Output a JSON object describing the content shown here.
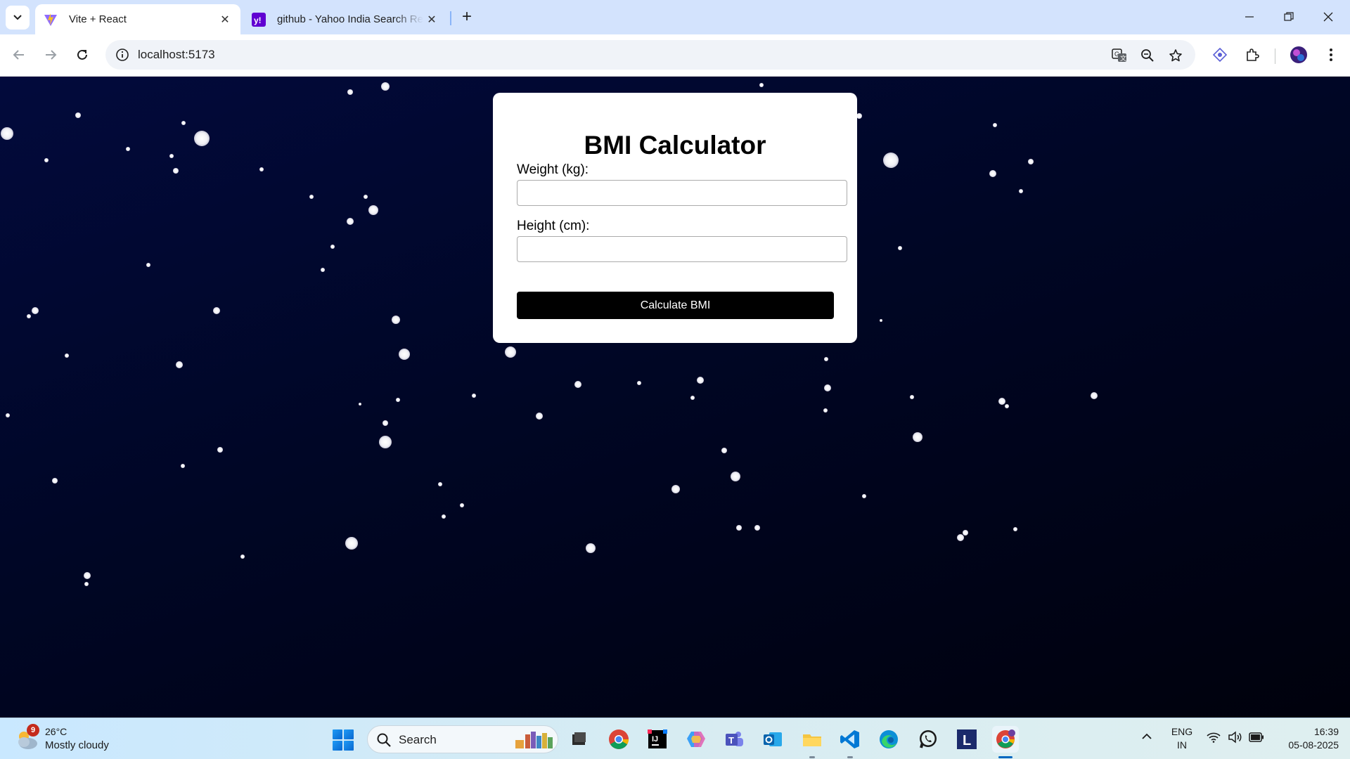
{
  "browser": {
    "tabs": [
      {
        "title": "Vite + React",
        "favicon": "vite-logo-icon",
        "active": true
      },
      {
        "title": "github - Yahoo India Search Results",
        "favicon": "yahoo-logo-icon",
        "active": false
      }
    ],
    "new_tab_symbol": "+",
    "close_symbol": "✕",
    "url": "localhost:5173"
  },
  "app": {
    "title": "BMI Calculator",
    "weight_label": "Weight (kg):",
    "weight_value": "",
    "height_label": "Height (cm):",
    "height_value": "",
    "button_label": "Calculate BMI",
    "background": "#020a3c",
    "card_color": "#ffffff",
    "button_color": "#000000"
  },
  "taskbar": {
    "weather_badge": "9",
    "weather_temp": "26°C",
    "weather_desc": "Mostly cloudy",
    "search_placeholder": "Search",
    "apps": [
      "file-explorer-dark-icon",
      "chrome-icon",
      "intellij-icon",
      "copilot-icon",
      "teams-icon",
      "outlook-icon",
      "folder-icon",
      "vscode-icon",
      "edge-icon",
      "whatsapp-icon",
      "l-app-icon",
      "chrome-profile-icon"
    ],
    "language_line1": "ENG",
    "language_line2": "IN",
    "time": "16:39",
    "date": "05-08-2025"
  }
}
